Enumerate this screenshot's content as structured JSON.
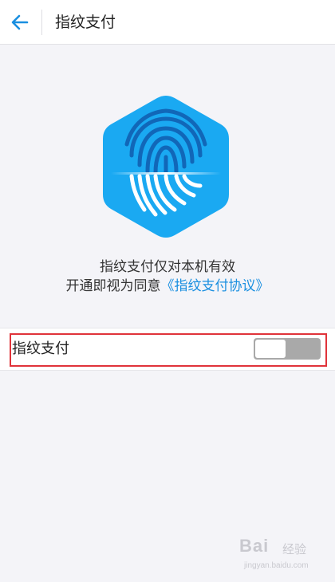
{
  "header": {
    "title": "指纹支付",
    "back_icon": "arrow-left-icon"
  },
  "hero": {
    "icon": "fingerprint-scan-icon",
    "notice_line1": "指纹支付仅对本机有效",
    "notice_line2_prefix": "开通即视为同意",
    "agreement_link": "《指纹支付协议》"
  },
  "setting": {
    "label": "指纹支付",
    "toggle_state": "off"
  },
  "watermark": {
    "brand": "Bai",
    "sub": "经验",
    "url": "jingyan.baidu.com"
  },
  "colors": {
    "accent": "#1a8fe0",
    "hex_fill": "#1aa9f2",
    "highlight_border": "#e0333a",
    "toggle_off": "#a9a9a9"
  }
}
